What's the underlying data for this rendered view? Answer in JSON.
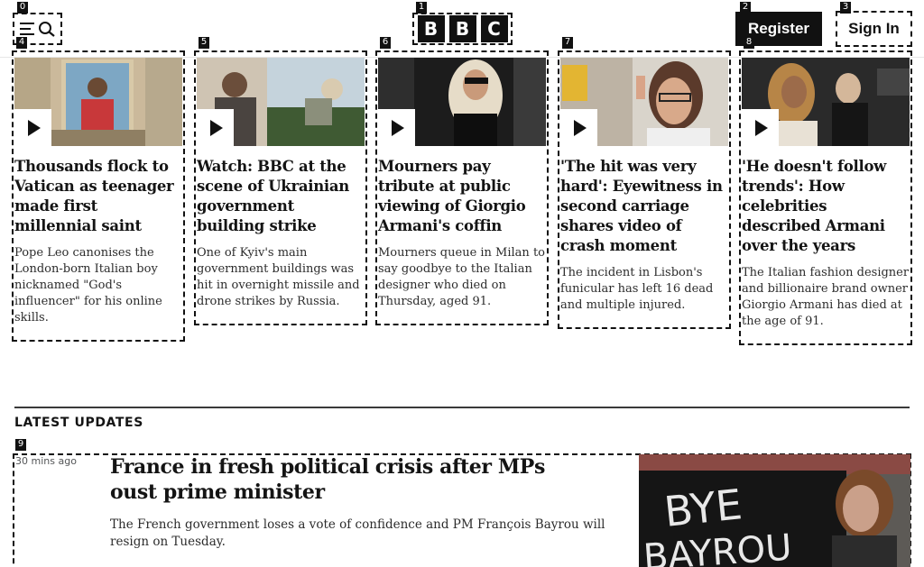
{
  "header": {
    "menu_icon": "menu-search-icon",
    "logo_letters": [
      "B",
      "B",
      "C"
    ],
    "register_label": "Register",
    "signin_label": "Sign In"
  },
  "cards": [
    {
      "headline": "Thousands flock to Vatican as teenager made first millennial saint",
      "summary": "Pope Leo canonises the London-born Italian boy nicknamed \"God's influencer\" for his online skills.",
      "has_video": true
    },
    {
      "headline": "Watch: BBC at the scene of Ukrainian government building strike",
      "summary": "One of Kyiv's main government buildings was hit in overnight missile and drone strikes by Russia.",
      "has_video": true
    },
    {
      "headline": "Mourners pay tribute at public viewing of Giorgio Armani's coffin",
      "summary": "Mourners queue in Milan to say goodbye to the Italian designer who died on Thursday, aged 91.",
      "has_video": true
    },
    {
      "headline": "'The hit was very hard': Eyewitness in second carriage shares video of crash moment",
      "summary": "The incident in Lisbon's funicular has left 16 dead and multiple injured.",
      "has_video": true
    },
    {
      "headline": "'He doesn't follow trends': How celebrities described Armani over the years",
      "summary": "The Italian fashion designer and billionaire brand owner Giorgio Armani has died at the age of 91.",
      "has_video": true
    }
  ],
  "latest": {
    "section_title": "LATEST UPDATES",
    "items": [
      {
        "time": "30 mins ago",
        "headline": "France in fresh political crisis after MPs oust prime minister",
        "summary": "The French government loses a vote of confidence and PM François Bayrou will resign on Tuesday.",
        "image_text": [
          "BYE",
          "BAYROU"
        ]
      }
    ]
  },
  "annotation_tags": [
    "0",
    "1",
    "2",
    "3",
    "4",
    "5",
    "6",
    "7",
    "8",
    "9"
  ]
}
